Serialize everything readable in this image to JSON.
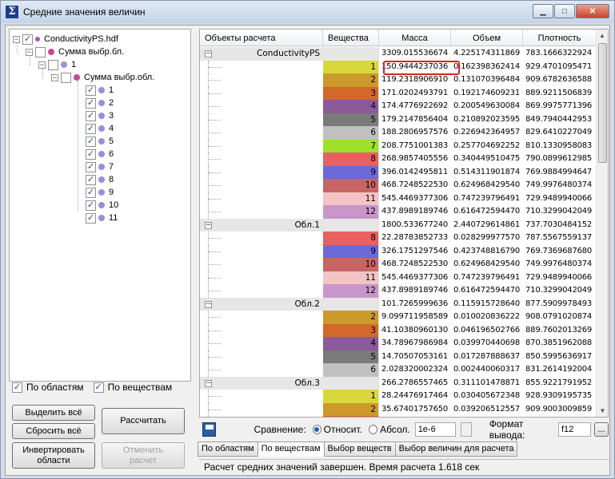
{
  "window": {
    "title": "Средние значения величин",
    "minimize": "▁",
    "maximize": "□",
    "close": "✕"
  },
  "tree": {
    "root": "ConductivityPS.hdf",
    "sum1": "Сумма выбр.бл.",
    "node1": "1",
    "sum2": "Сумма выбр.обл.",
    "items": [
      "1",
      "2",
      "3",
      "4",
      "5",
      "6",
      "7",
      "8",
      "9",
      "10",
      "11"
    ]
  },
  "options": {
    "by_regions": "По областям",
    "by_substances": "По веществам"
  },
  "buttons": {
    "select_all": "Выделить всё",
    "reset_all": "Сбросить всё",
    "calculate": "Рассчитать",
    "invert": "Инвертировать области",
    "cancel": "Отменить расчет"
  },
  "grid": {
    "headers": [
      "Объекты расчета",
      "Вещества",
      "Масса",
      "Объем",
      "Плотность"
    ],
    "rows": [
      {
        "type": "group",
        "name": "ConductivityPS",
        "sub": "",
        "color": "#e6e6e6",
        "mass": "3309.015536674",
        "vol": "4.225174311869",
        "dens": "783.1666322924"
      },
      {
        "type": "item",
        "name": "",
        "sub": "1",
        "color": "#d8d83a",
        "mass": "150.9444237036",
        "vol": "0.162398362414",
        "dens": "929.4701095471"
      },
      {
        "type": "item",
        "name": "",
        "sub": "2",
        "color": "#cc9a2a",
        "mass": "119.2318906910",
        "vol": "0.131070396484",
        "dens": "909.6782636588"
      },
      {
        "type": "item",
        "name": "",
        "sub": "3",
        "color": "#d2692a",
        "mass": "171.0202493791",
        "vol": "0.192174609231",
        "dens": "889.9211506839"
      },
      {
        "type": "item",
        "name": "",
        "sub": "4",
        "color": "#8a5a9a",
        "mass": "174.4776922692",
        "vol": "0.200549630084",
        "dens": "869.9975771396"
      },
      {
        "type": "item",
        "name": "",
        "sub": "5",
        "color": "#7a7a7a",
        "mass": "179.2147856404",
        "vol": "0.210892023595",
        "dens": "849.7940442953"
      },
      {
        "type": "item",
        "name": "",
        "sub": "6",
        "color": "#c0c0c0",
        "mass": "188.2806957576",
        "vol": "0.226942364957",
        "dens": "829.6410227049"
      },
      {
        "type": "item",
        "name": "",
        "sub": "7",
        "color": "#9ee02a",
        "mass": "208.7751001383",
        "vol": "0.257704692252",
        "dens": "810.1330958083"
      },
      {
        "type": "item",
        "name": "",
        "sub": "8",
        "color": "#e86060",
        "mass": "268.9857405556",
        "vol": "0.340449510475",
        "dens": "790.0899612985"
      },
      {
        "type": "item",
        "name": "",
        "sub": "9",
        "color": "#6a6ad8",
        "mass": "396.0142495811",
        "vol": "0.514311901874",
        "dens": "769.9884994647"
      },
      {
        "type": "item",
        "name": "",
        "sub": "10",
        "color": "#c86464",
        "mass": "468.7248522530",
        "vol": "0.624968429540",
        "dens": "749.9976480374"
      },
      {
        "type": "item",
        "name": "",
        "sub": "11",
        "color": "#f4c4c4",
        "mass": "545.4469377306",
        "vol": "0.747239796491",
        "dens": "729.9489940066"
      },
      {
        "type": "item",
        "name": "",
        "sub": "12",
        "color": "#c896c8",
        "mass": "437.8989189746",
        "vol": "0.616472594470",
        "dens": "710.3299042049"
      },
      {
        "type": "group",
        "name": "Обл.1",
        "sub": "",
        "color": "#e6e6e6",
        "mass": "1800.533677240",
        "vol": "2.440729614861",
        "dens": "737.7030484152"
      },
      {
        "type": "item",
        "name": "",
        "sub": "8",
        "color": "#e86060",
        "mass": "22.28783852733",
        "vol": "0.028299977570",
        "dens": "787.5567559137"
      },
      {
        "type": "item",
        "name": "",
        "sub": "9",
        "color": "#6a6ad8",
        "mass": "326.1751297546",
        "vol": "0.423748816790",
        "dens": "769.7369687680"
      },
      {
        "type": "item",
        "name": "",
        "sub": "10",
        "color": "#c86464",
        "mass": "468.7248522530",
        "vol": "0.624968429540",
        "dens": "749.9976480374"
      },
      {
        "type": "item",
        "name": "",
        "sub": "11",
        "color": "#f4c4c4",
        "mass": "545.4469377306",
        "vol": "0.747239796491",
        "dens": "729.9489940066"
      },
      {
        "type": "item",
        "name": "",
        "sub": "12",
        "color": "#c896c8",
        "mass": "437.8989189746",
        "vol": "0.616472594470",
        "dens": "710.3299042049"
      },
      {
        "type": "group",
        "name": "Обл.2",
        "sub": "",
        "color": "#e6e6e6",
        "mass": "101.7265999636",
        "vol": "0.115915728640",
        "dens": "877.5909978493"
      },
      {
        "type": "item",
        "name": "",
        "sub": "2",
        "color": "#cc9a2a",
        "mass": "9.099711958589",
        "vol": "0.010020836222",
        "dens": "908.0791020874"
      },
      {
        "type": "item",
        "name": "",
        "sub": "3",
        "color": "#d2692a",
        "mass": "41.10380960130",
        "vol": "0.046196502766",
        "dens": "889.7602013269"
      },
      {
        "type": "item",
        "name": "",
        "sub": "4",
        "color": "#8a5a9a",
        "mass": "34.78967986984",
        "vol": "0.039970440698",
        "dens": "870.3851962088"
      },
      {
        "type": "item",
        "name": "",
        "sub": "5",
        "color": "#7a7a7a",
        "mass": "14.70507053161",
        "vol": "0.017287888637",
        "dens": "850.5995636917"
      },
      {
        "type": "item",
        "name": "",
        "sub": "6",
        "color": "#c0c0c0",
        "mass": "2.028320002324",
        "vol": "0.002440060317",
        "dens": "831.2614192004"
      },
      {
        "type": "group",
        "name": "Обл.3",
        "sub": "",
        "color": "#e6e6e6",
        "mass": "266.2786557465",
        "vol": "0.311101478871",
        "dens": "855.9221791952"
      },
      {
        "type": "item",
        "name": "",
        "sub": "1",
        "color": "#d8d83a",
        "mass": "28.24476917464",
        "vol": "0.030405672348",
        "dens": "928.9309195735"
      },
      {
        "type": "item",
        "name": "",
        "sub": "2",
        "color": "#cc9a2a",
        "mass": "35.67401757650",
        "vol": "0.039206512557",
        "dens": "909.9003009859"
      },
      {
        "type": "item",
        "name": "",
        "sub": "3",
        "color": "#d2692a",
        "mass": "36.48967558496",
        "vol": "0.040995960410",
        "dens": "890.0797839492"
      }
    ]
  },
  "toolbar": {
    "compare_label": "Сравнение:",
    "relative": "Относит.",
    "absolute": "Абсол.",
    "tolerance": "1e-6",
    "format_label": "Формат вывода:",
    "format_value": "f12",
    "more": "..."
  },
  "tabs": [
    "По областям",
    "По веществам",
    "Выбор веществ",
    "Выбор величин для расчета"
  ],
  "status": "Расчет средних значений завершен. Время расчета 1.618 сек",
  "colors": {
    "accent": "#1f5fbf",
    "highlight": "#e0201e",
    "tree_dot": "#9b8ed8"
  }
}
